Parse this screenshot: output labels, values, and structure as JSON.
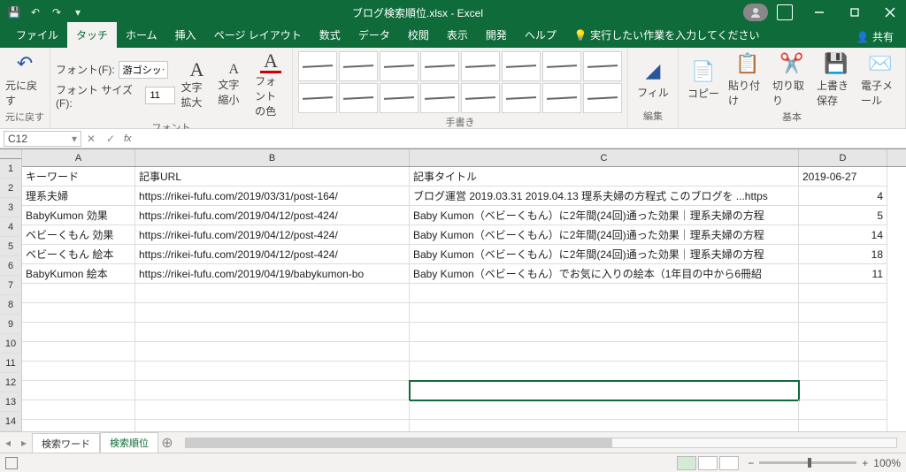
{
  "title_suffix": " - Excel",
  "filename": "ブログ検索順位.xlsx",
  "tabs": [
    "ファイル",
    "タッチ",
    "ホーム",
    "挿入",
    "ページ レイアウト",
    "数式",
    "データ",
    "校閲",
    "表示",
    "開発",
    "ヘルプ"
  ],
  "tell_me": "実行したい作業を入力してください",
  "share": "共有",
  "ribbon": {
    "undo_grp": "元に戻す",
    "undo": "元に戻す",
    "font_grp": "フォント",
    "font_label": "フォント(F):",
    "font_value": "游ゴシック",
    "size_label": "フォント サイズ(F):",
    "size_value": "11",
    "grow": "文字拡大",
    "shrink": "文字縮小",
    "color": "フォントの色",
    "ink_grp": "手書き",
    "fill": "フィル",
    "edit_grp": "編集",
    "copy": "コピー",
    "paste": "貼り付け",
    "cut": "切り取り",
    "save": "上書き保存",
    "mail": "電子メール",
    "basic_grp": "基本"
  },
  "namebox": "C12",
  "columns": [
    "A",
    "B",
    "C",
    "D"
  ],
  "rows": [
    {
      "A": "キーワード",
      "B": "記事URL",
      "C": "記事タイトル",
      "D": "2019-06-27"
    },
    {
      "A": "理系夫婦",
      "B": "https://rikei-fufu.com/2019/03/31/post-164/",
      "C": "ブログ運営 2019.03.31 2019.04.13 理系夫婦の方程式 このブログを ...https",
      "D": "4"
    },
    {
      "A": "BabyKumon 効果",
      "B": "https://rikei-fufu.com/2019/04/12/post-424/",
      "C": "Baby Kumon（ベビーくもん）に2年間(24回)通った効果｜理系夫婦の方程",
      "D": "5"
    },
    {
      "A": "ベビーくもん 効果",
      "B": "https://rikei-fufu.com/2019/04/12/post-424/",
      "C": "Baby Kumon（ベビーくもん）に2年間(24回)通った効果｜理系夫婦の方程",
      "D": "14"
    },
    {
      "A": "ベビーくもん 絵本",
      "B": "https://rikei-fufu.com/2019/04/12/post-424/",
      "C": "Baby Kumon（ベビーくもん）に2年間(24回)通った効果｜理系夫婦の方程",
      "D": "18"
    },
    {
      "A": "BabyKumon 絵本",
      "B": "https://rikei-fufu.com/2019/04/19/babykumon-bo",
      "C": "Baby Kumon（ベビーくもん）でお気に入りの絵本（1年目の中から6冊紹",
      "D": "11"
    }
  ],
  "sheets": [
    "検索ワード",
    "検索順位"
  ],
  "active_sheet": 1,
  "zoom": "100%"
}
